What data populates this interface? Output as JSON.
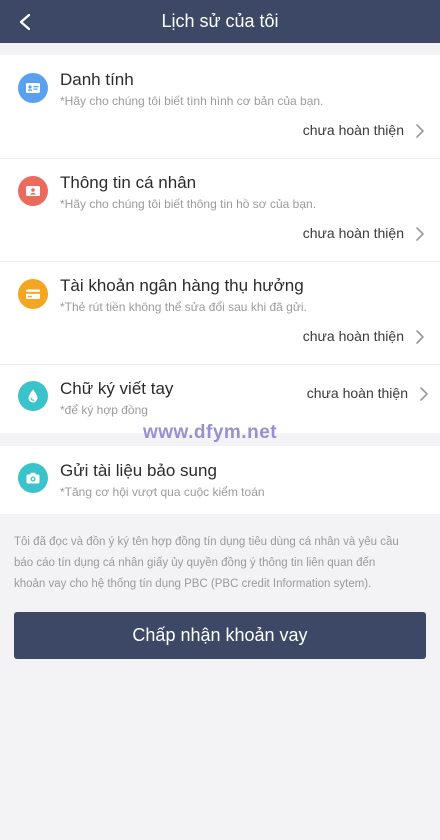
{
  "header": {
    "title": "Lịch sử của tôi"
  },
  "items": [
    {
      "title": "Danh tính",
      "description": "*Hãy cho chúng tôi biết tình hình cơ bản của bạn.",
      "status": "chưa hoàn thiện",
      "icon": "id-card-icon",
      "color": "#5aa0ee"
    },
    {
      "title": "Thông tin cá nhân",
      "description": "*Hãy cho chúng tôi biết thông tin hồ sơ của bạn.",
      "status": "chưa hoàn thiện",
      "icon": "profile-card-icon",
      "color": "#ea6a5c"
    },
    {
      "title": "Tài khoản ngân hàng thụ hưởng",
      "description": "*Thẻ rút tiền không thể sửa đổi sau khi đã gửi.",
      "status": "chưa hoàn thiện",
      "icon": "bank-card-icon",
      "color": "#f4a622"
    },
    {
      "title": "Chữ ký viết tay",
      "description": "*để ký hợp đồng",
      "status": "chưa hoàn thiện",
      "icon": "signature-drop-icon",
      "color": "#3bc3cc"
    }
  ],
  "supplement": {
    "title": "Gửi tài liệu bảo sung",
    "description": "*Tăng cơ hội vượt qua cuộc kiểm toán",
    "icon": "camera-icon",
    "color": "#3bc3cc"
  },
  "watermark": "www.dfym.net",
  "agreement": {
    "line1": "Tôi đã đọc và đồn ý ký tên hợp đồng tín dụng tiêu dùng cá nhân và yêu cầu",
    "line2": "báo cáo tín dụng cá nhân giấy ủy quyền đồng ý thông tin liên quan đến",
    "line3": "khoản vay cho hệ thống tín dụng PBC (PBC credit Information sytem)."
  },
  "accept_button": "Chấp nhận khoản vay"
}
